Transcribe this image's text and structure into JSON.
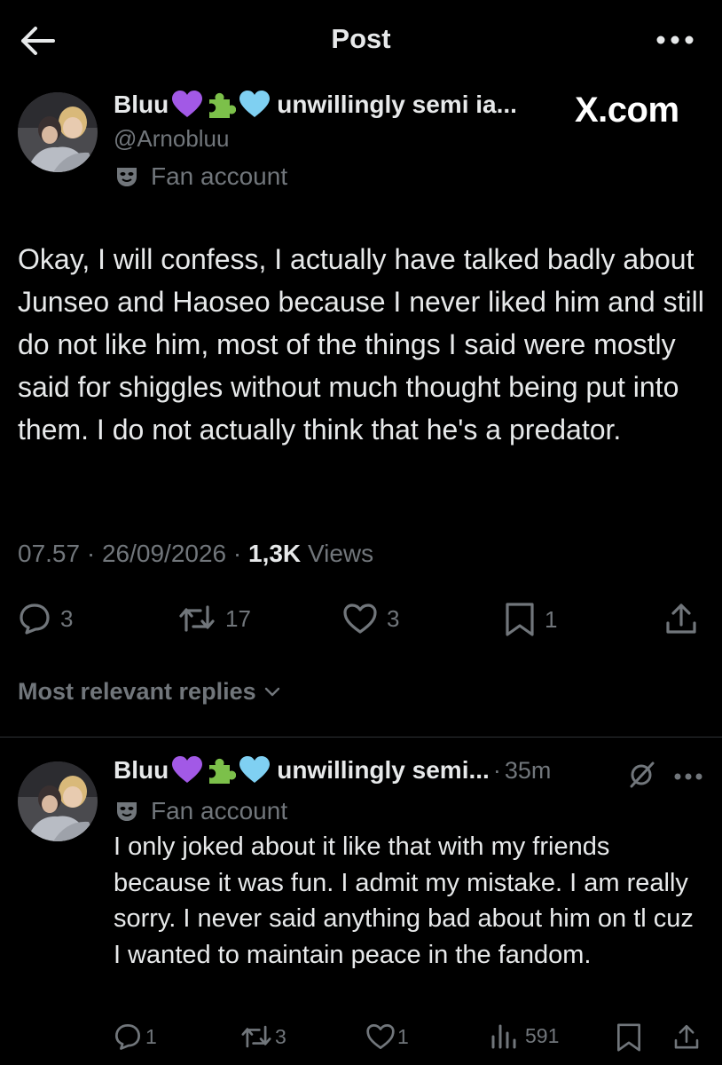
{
  "header": {
    "title": "Post",
    "back_icon": "arrow-left-icon",
    "more_icon": "more-dots-icon"
  },
  "watermark": "X.com",
  "post": {
    "author": {
      "display_name": "Bluu",
      "emojis": [
        "purple-heart",
        "puzzle-piece",
        "light-blue-heart"
      ],
      "name_suffix": "unwillingly semi ia...",
      "handle": "@Arnobluu",
      "badge_icon": "mask-icon",
      "badge_label": "Fan account"
    },
    "text": "Okay, I will confess, I actually have talked badly about Junseo and Haoseo because I never liked him and still do not like him, most of the things I said were mostly said for shiggles without much thought being put into them. I do not actually think that he's a predator.",
    "time": "07.57",
    "separator": "·",
    "date": "26/09/2026",
    "views_count": "1,3K",
    "views_label": "Views",
    "stats": {
      "replies": "3",
      "reposts": "17",
      "likes": "3",
      "bookmarks": "1"
    }
  },
  "replies_section": {
    "label": "Most relevant replies"
  },
  "reply": {
    "author": {
      "display_name": "Bluu",
      "name_suffix": "unwillingly semi...",
      "time": "35m",
      "badge_label": "Fan account"
    },
    "text": "I only joked about it like that with my friends because it was fun. I admit my mistake. I am really sorry. I never said anything bad about him on tl cuz I wanted to maintain peace in the fandom.",
    "stats": {
      "replies": "1",
      "reposts": "3",
      "likes": "1",
      "views": "591"
    }
  },
  "colors": {
    "background": "#000000",
    "text": "#e7e9ea",
    "muted": "#71767b",
    "divider": "#2f3336",
    "purple_heart": "#a259e6",
    "blue_heart": "#7fd0f2",
    "puzzle": "#7cc04a"
  }
}
